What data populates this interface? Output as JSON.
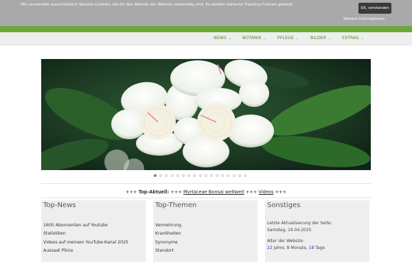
{
  "cookie": {
    "message": "Wir verwenden ausschließlich Session-Cookies, die für den Betrieb der Website notwendig sind. Es werden keinerlei Tracking-Cookies gesetzt.",
    "ok_label": "Ok, verstanden",
    "more_label": "Weitere Informationen"
  },
  "nav": {
    "items": [
      {
        "label": "NEWS"
      },
      {
        "label": "BOTANIK"
      },
      {
        "label": "PFLEGE"
      },
      {
        "label": "BILDER"
      },
      {
        "label": "EXTRAS"
      }
    ]
  },
  "slider": {
    "dot_count": 17,
    "active_index": 0
  },
  "ticker": {
    "sep": "+++",
    "prefix": "Top-Aktuell:",
    "link1": "Myrtaceae Bonsai weltweit",
    "link2": "Videos"
  },
  "columns": {
    "news": {
      "title": "Top-News",
      "items": [
        "1600 Abonnenten auf Youtube",
        "Statistiken",
        "Videos auf meinem YouTube-Kanal 2025",
        "Aussaat Plinia"
      ]
    },
    "themen": {
      "title": "Top-Themen",
      "items": [
        "Vermehrung",
        "Krankheiten",
        "Synonyme",
        "Standort"
      ]
    },
    "sonstiges": {
      "title": "Sonstiges",
      "update_label": "Letzte Aktualisierung der Seite:",
      "update_date": "Samstag, 19.04.2025",
      "age_label": "Alter der Website:",
      "years": "22",
      "years_unit": "Jahre,",
      "months": "8",
      "months_unit": "Monate,",
      "days": "18",
      "days_unit": "Tage"
    }
  },
  "colors": {
    "green": "#6aa738",
    "nav_text": "#4d8a22",
    "cookie_bg": "#a9a9a9"
  }
}
